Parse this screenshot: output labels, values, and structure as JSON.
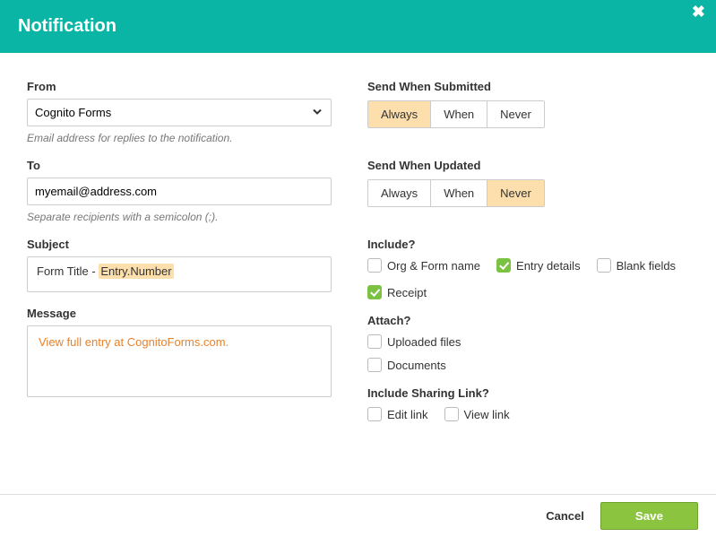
{
  "header": {
    "title": "Notification"
  },
  "from": {
    "label": "From",
    "value": "Cognito Forms",
    "helper": "Email address for replies to the notification."
  },
  "to": {
    "label": "To",
    "value": "myemail@address.com",
    "helper": "Separate recipients with a semicolon (;)."
  },
  "subject": {
    "label": "Subject",
    "prefix": "Form Title - ",
    "token": "Entry.Number"
  },
  "message": {
    "label": "Message",
    "linkText": "View full entry at CognitoForms.com."
  },
  "sendSubmitted": {
    "label": "Send When Submitted",
    "options": [
      "Always",
      "When",
      "Never"
    ],
    "selected": "Always"
  },
  "sendUpdated": {
    "label": "Send When Updated",
    "options": [
      "Always",
      "When",
      "Never"
    ],
    "selected": "Never"
  },
  "include": {
    "label": "Include?",
    "items": [
      {
        "label": "Org & Form name",
        "checked": false
      },
      {
        "label": "Entry details",
        "checked": true
      },
      {
        "label": "Blank fields",
        "checked": false
      },
      {
        "label": "Receipt",
        "checked": true
      }
    ]
  },
  "attach": {
    "label": "Attach?",
    "items": [
      {
        "label": "Uploaded files",
        "checked": false
      },
      {
        "label": "Documents",
        "checked": false
      }
    ]
  },
  "sharing": {
    "label": "Include Sharing Link?",
    "items": [
      {
        "label": "Edit link",
        "checked": false
      },
      {
        "label": "View link",
        "checked": false
      }
    ]
  },
  "footer": {
    "cancel": "Cancel",
    "save": "Save"
  }
}
